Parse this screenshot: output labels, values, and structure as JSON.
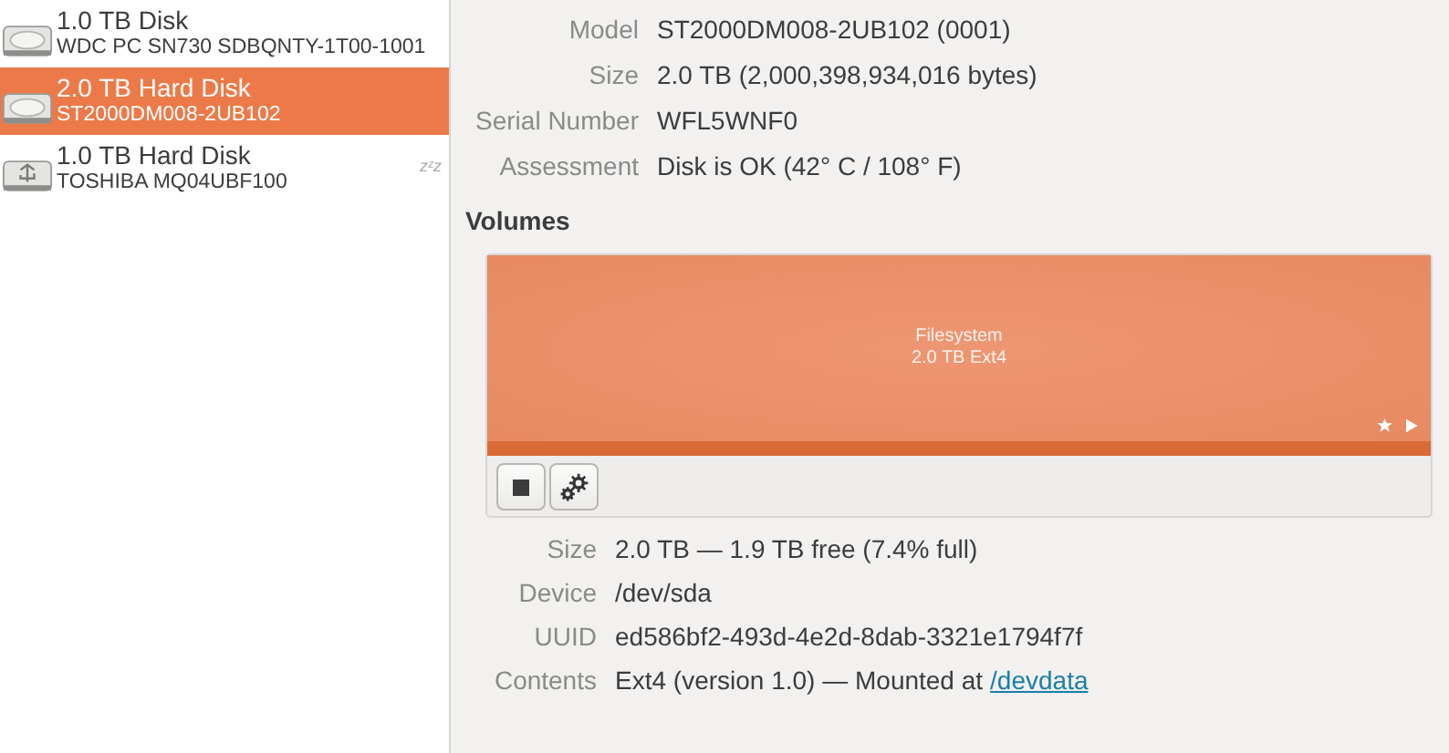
{
  "disks": [
    {
      "kind": "hdd",
      "title": "1.0 TB Disk",
      "subtitle": "WDC PC SN730 SDBQNTY-1T00-1001",
      "selected": false
    },
    {
      "kind": "hdd",
      "title": "2.0 TB Hard Disk",
      "subtitle": "ST2000DM008-2UB102",
      "selected": true
    },
    {
      "kind": "usb",
      "title": "1.0 TB Hard Disk",
      "subtitle": "TOSHIBA MQ04UBF100",
      "selected": false,
      "sleep_mark": "zᶻz"
    }
  ],
  "drive_details": [
    {
      "label": "Model",
      "value": "ST2000DM008-2UB102 (0001)"
    },
    {
      "label": "Size",
      "value": "2.0 TB (2,000,398,934,016 bytes)"
    },
    {
      "label": "Serial Number",
      "value": "WFL5WNF0"
    },
    {
      "label": "Assessment",
      "value": "Disk is OK (42° C / 108° F)"
    }
  ],
  "volumes": {
    "heading": "Volumes",
    "partition": {
      "name": "Filesystem",
      "size": "2.0 TB Ext4",
      "selected": true
    },
    "details": [
      {
        "label": "Size",
        "value": "2.0 TB — 1.9 TB free (7.4% full)"
      },
      {
        "label": "Device",
        "value": "/dev/sda"
      },
      {
        "label": "UUID",
        "value": "ed586bf2-493d-4e2d-8dab-3321e1794f7f"
      },
      {
        "label": "Contents",
        "value": "Ext4 (version 1.0) — Mounted at",
        "link": "/devdata"
      }
    ]
  }
}
